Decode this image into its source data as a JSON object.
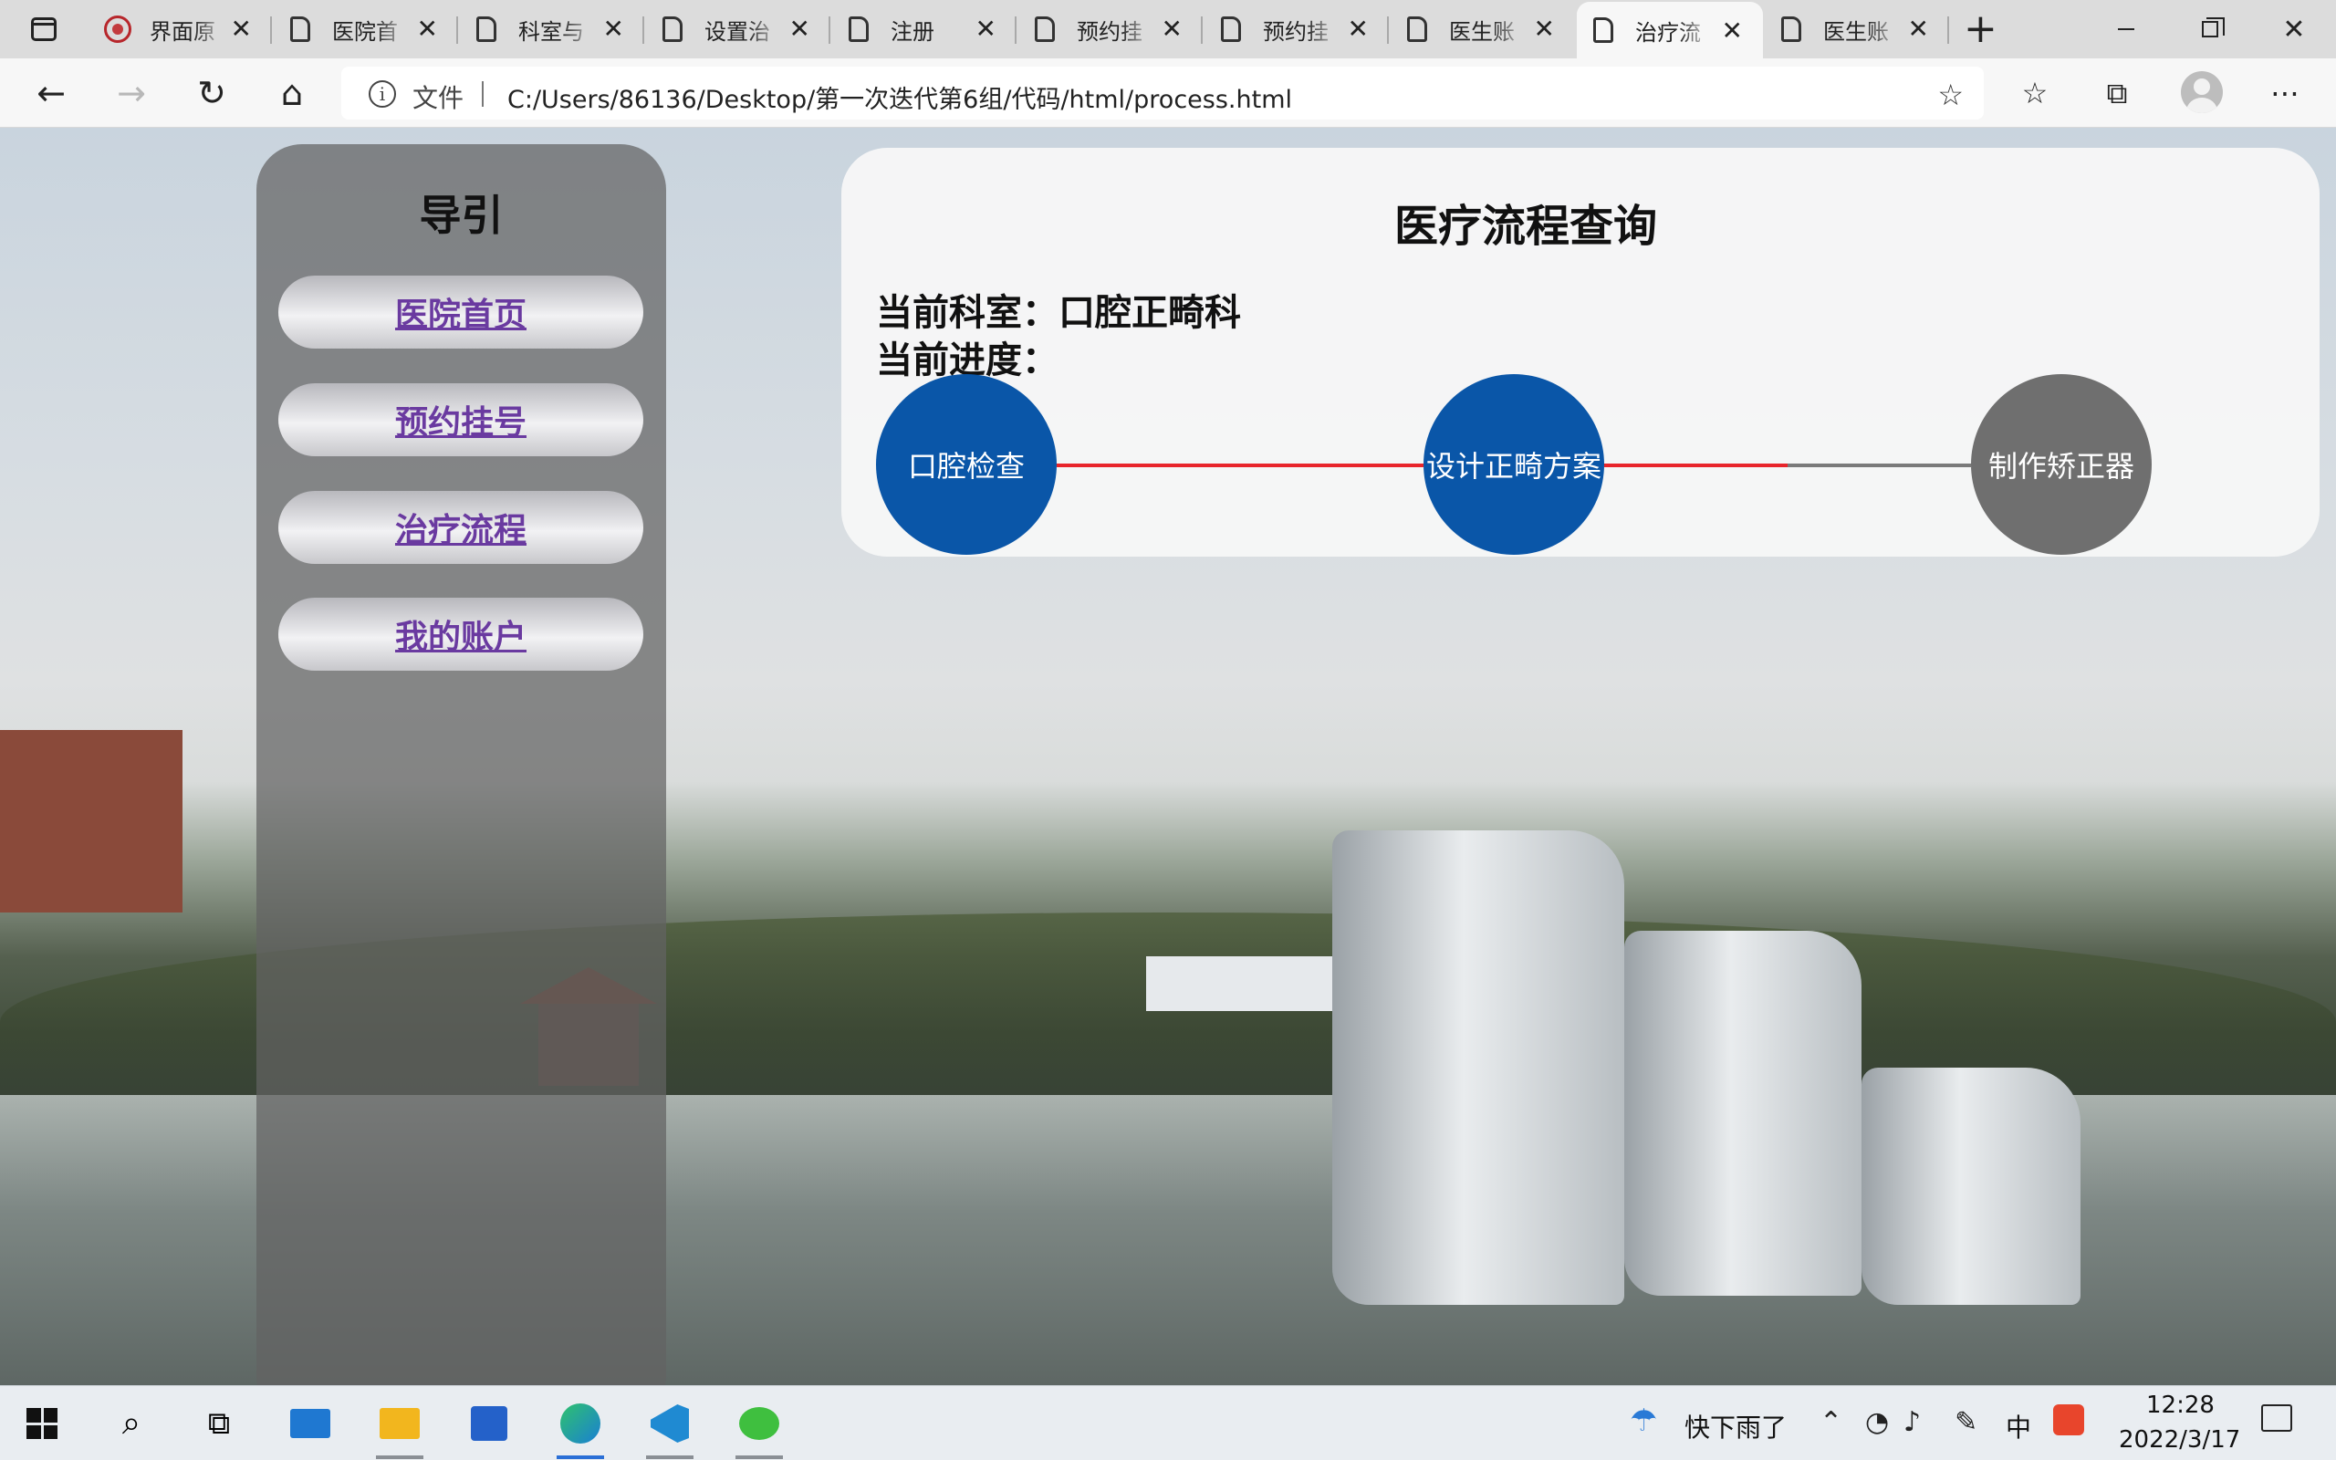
{
  "browser": {
    "tabs": [
      {
        "title": "界面原",
        "icon": "site-logo-icon",
        "active": false
      },
      {
        "title": "医院首",
        "icon": "document-icon",
        "active": false
      },
      {
        "title": "科室与",
        "icon": "document-icon",
        "active": false
      },
      {
        "title": "设置治",
        "icon": "document-icon",
        "active": false
      },
      {
        "title": "注册",
        "icon": "document-icon",
        "active": false
      },
      {
        "title": "预约挂",
        "icon": "document-icon",
        "active": false
      },
      {
        "title": "预约挂",
        "icon": "document-icon",
        "active": false
      },
      {
        "title": "医生账",
        "icon": "document-icon",
        "active": false
      },
      {
        "title": "治疗流",
        "icon": "document-icon",
        "active": true
      },
      {
        "title": "医生账",
        "icon": "document-icon",
        "active": false
      }
    ],
    "close_glyph": "✕",
    "new_tab_glyph": "+",
    "address": {
      "protocol_label": "文件",
      "url": "C:/Users/86136/Desktop/第一次迭代第6组/代码/html/process.html"
    }
  },
  "page": {
    "sidebar": {
      "title": "导引",
      "items": [
        {
          "label": "医院首页"
        },
        {
          "label": "预约挂号"
        },
        {
          "label": "治疗流程"
        },
        {
          "label": "我的账户"
        }
      ]
    },
    "panel": {
      "title": "医疗流程查询",
      "department_label": "当前科室：",
      "department_value": "口腔正畸科",
      "progress_label": "当前进度：",
      "steps": [
        {
          "label": "口腔检查",
          "status": "done"
        },
        {
          "label": "设计正畸方案",
          "status": "done"
        },
        {
          "label": "制作矫正器",
          "status": "pending"
        }
      ]
    }
  },
  "colors": {
    "step_done": "#0a56a8",
    "step_pending": "#6f6f6f",
    "connector_done": "#e8252b",
    "connector_pending": "#7a7a7a",
    "nav_link": "#6a3aa0"
  },
  "taskbar": {
    "weather": "快下雨了",
    "ime": "中",
    "time": "12:28",
    "date": "2022/3/17"
  }
}
